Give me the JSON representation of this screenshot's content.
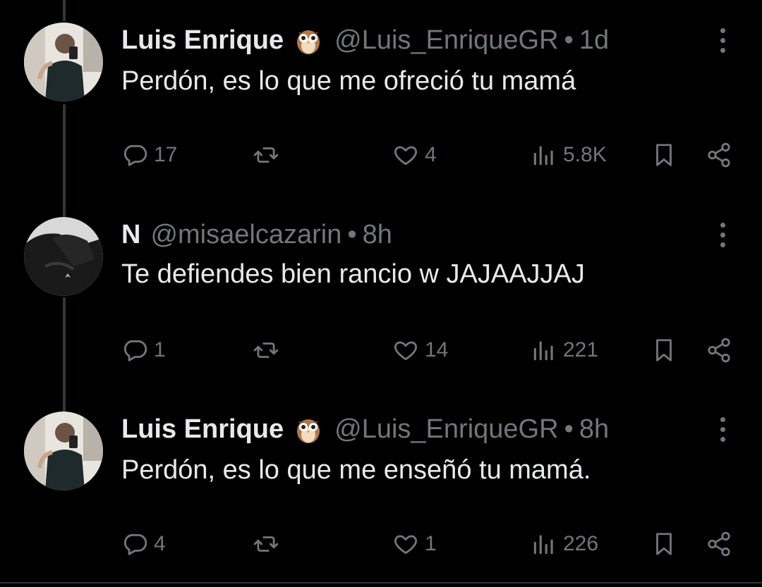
{
  "tweets": [
    {
      "name": "Luis Enrique",
      "handle": "@Luis_EnriqueGR",
      "separator": "•",
      "time": "1d",
      "text": "Perdón, es lo que me ofreció tu mamá",
      "avatar": "profile-photo",
      "badge_icon": "owl-emoji",
      "replies": "17",
      "retweets": "",
      "likes": "4",
      "views": "5.8K"
    },
    {
      "name": "N",
      "handle": "@misaelcazarin",
      "separator": "•",
      "time": "8h",
      "text": "Te defiendes bien rancio w JAJAAJJAJ",
      "avatar": "dark-jacket-photo",
      "badge_icon": "",
      "replies": "1",
      "retweets": "",
      "likes": "14",
      "views": "221"
    },
    {
      "name": "Luis Enrique",
      "handle": "@Luis_EnriqueGR",
      "separator": "•",
      "time": "8h",
      "text": "Perdón, es lo que me enseñó tu mamá.",
      "avatar": "profile-photo",
      "badge_icon": "owl-emoji",
      "replies": "4",
      "retweets": "",
      "likes": "1",
      "views": "226"
    }
  ],
  "icons": {
    "reply": "reply-icon",
    "retweet": "retweet-icon",
    "like": "heart-icon",
    "views": "views-icon",
    "bookmark": "bookmark-icon",
    "share": "share-icon",
    "more": "more-icon"
  },
  "colors": {
    "background": "#000000",
    "text": "#e7e9ea",
    "secondary": "#71767b",
    "thread_line": "#333639"
  }
}
